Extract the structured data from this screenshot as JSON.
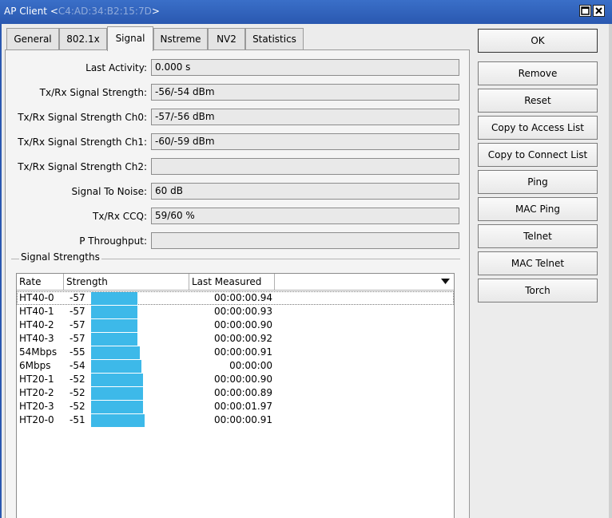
{
  "window": {
    "title_prefix": "AP Client <",
    "title_mac": "C4:AD:34:B2:15:7D",
    "title_suffix": ">"
  },
  "tabs": [
    {
      "label": "General",
      "active": false
    },
    {
      "label": "802.1x",
      "active": false
    },
    {
      "label": "Signal",
      "active": true
    },
    {
      "label": "Nstreme",
      "active": false
    },
    {
      "label": "NV2",
      "active": false
    },
    {
      "label": "Statistics",
      "active": false
    }
  ],
  "fields": [
    {
      "label": "Last Activity:",
      "value": "0.000 s"
    },
    {
      "label": "Tx/Rx Signal Strength:",
      "value": "-56/-54 dBm"
    },
    {
      "label": "Tx/Rx Signal Strength Ch0:",
      "value": "-57/-56 dBm"
    },
    {
      "label": "Tx/Rx Signal Strength Ch1:",
      "value": "-60/-59 dBm"
    },
    {
      "label": "Tx/Rx Signal Strength Ch2:",
      "value": ""
    },
    {
      "label": "Signal To Noise:",
      "value": "60 dB"
    },
    {
      "label": "Tx/Rx CCQ:",
      "value": "59/60 %"
    },
    {
      "label": "P Throughput:",
      "value": ""
    }
  ],
  "signal_section": {
    "title": "Signal Strengths",
    "columns": [
      "Rate",
      "Strength",
      "Last Measured",
      ""
    ],
    "bar_color": "#3db9e9",
    "rows": [
      {
        "rate": "HT40-0",
        "strength": "-57",
        "last": "00:00:00.94"
      },
      {
        "rate": "HT40-1",
        "strength": "-57",
        "last": "00:00:00.93"
      },
      {
        "rate": "HT40-2",
        "strength": "-57",
        "last": "00:00:00.90"
      },
      {
        "rate": "HT40-3",
        "strength": "-57",
        "last": "00:00:00.92"
      },
      {
        "rate": "54Mbps",
        "strength": "-55",
        "last": "00:00:00.91"
      },
      {
        "rate": "6Mbps",
        "strength": "-54",
        "last": "00:00:00"
      },
      {
        "rate": "HT20-1",
        "strength": "-52",
        "last": "00:00:00.90"
      },
      {
        "rate": "HT20-2",
        "strength": "-52",
        "last": "00:00:00.89"
      },
      {
        "rate": "HT20-3",
        "strength": "-52",
        "last": "00:00:01.97"
      },
      {
        "rate": "HT20-0",
        "strength": "-51",
        "last": "00:00:00.91"
      }
    ]
  },
  "buttons": {
    "ok": "OK",
    "remove": "Remove",
    "reset": "Reset",
    "copy_access": "Copy to Access List",
    "copy_connect": "Copy to Connect List",
    "ping": "Ping",
    "mac_ping": "MAC Ping",
    "telnet": "Telnet",
    "mac_telnet": "MAC Telnet",
    "torch": "Torch"
  }
}
